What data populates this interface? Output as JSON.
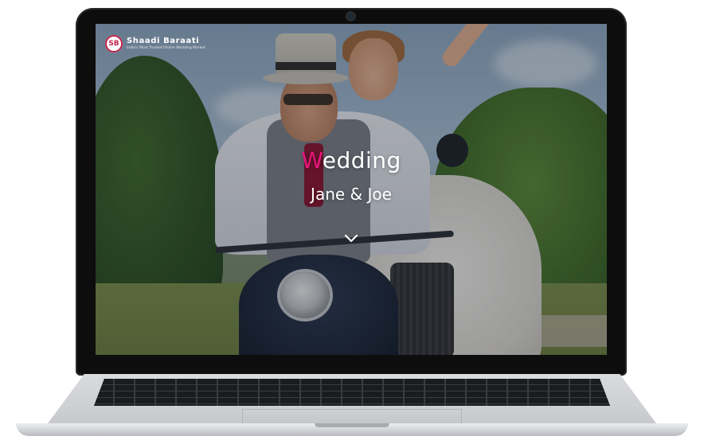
{
  "logo": {
    "name": "Shaadi Baraati",
    "tagline": "India's Most Trusted Online Wedding Market",
    "icon": "shaadi-baraati-logo-icon"
  },
  "hero": {
    "title_accent": "W",
    "title_rest": "edding",
    "names": "Jane & Joe",
    "scroll_icon": "chevron-down-icon"
  },
  "colors": {
    "accent": "#e6157a",
    "bezel": "#0d0d0d",
    "chassis": "#c7c9cc"
  }
}
